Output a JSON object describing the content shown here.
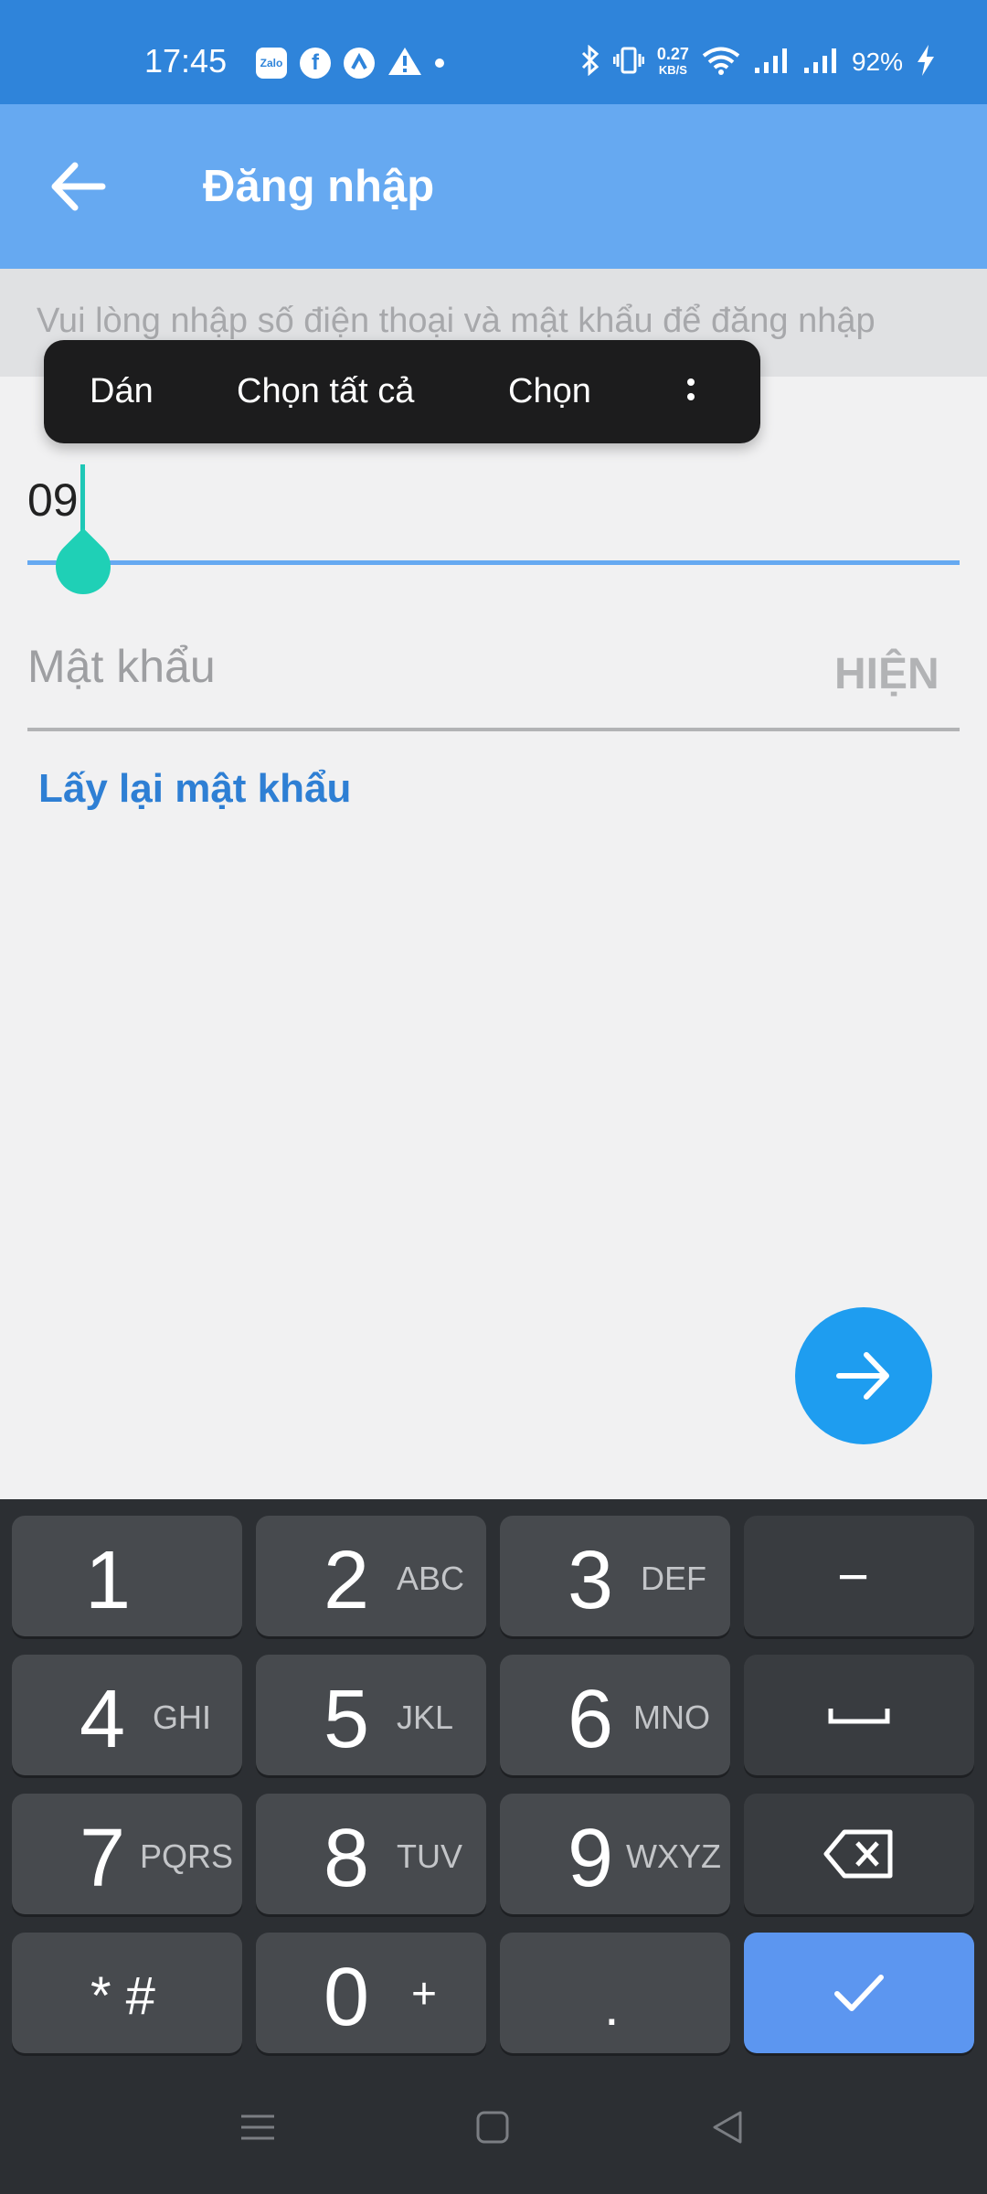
{
  "status_bar": {
    "time": "17:45",
    "notification_icons": [
      "zalo-icon",
      "facebook-icon",
      "arrow-up-icon",
      "warning-icon",
      "dot-icon"
    ],
    "zalo_label": "Zalo",
    "network_speed_value": "0.27",
    "network_speed_unit": "KB/S",
    "battery": "92%",
    "system_icons": [
      "bluetooth-icon",
      "vibrate-icon",
      "wifi-icon",
      "signal-icon",
      "signal-icon",
      "charging-icon"
    ]
  },
  "app_bar": {
    "title": "Đăng nhập",
    "back_icon": "arrow-left-icon"
  },
  "instruction": "Vui lòng nhập số điện thoại và mật khẩu để đăng nhập",
  "context_menu": {
    "items": [
      "Dán",
      "Chọn tất cả",
      "Chọn"
    ],
    "more_icon": "more-vertical-icon"
  },
  "phone_field": {
    "value": "09"
  },
  "password_field": {
    "placeholder": "Mật khẩu",
    "show_label": "HIỆN"
  },
  "forgot_password": "Lấy lại mật khẩu",
  "next_button_icon": "arrow-right-icon",
  "keyboard": {
    "rows": [
      [
        {
          "main": "1",
          "sub": ""
        },
        {
          "main": "2",
          "sub": "ABC"
        },
        {
          "main": "3",
          "sub": "DEF"
        },
        {
          "main": "−",
          "sub": ""
        }
      ],
      [
        {
          "main": "4",
          "sub": "GHI"
        },
        {
          "main": "5",
          "sub": "JKL"
        },
        {
          "main": "6",
          "sub": "MNO"
        },
        {
          "main": "",
          "sub": "",
          "icon": "space-icon"
        }
      ],
      [
        {
          "main": "7",
          "sub": "PQRS"
        },
        {
          "main": "8",
          "sub": "TUV"
        },
        {
          "main": "9",
          "sub": "WXYZ"
        },
        {
          "main": "",
          "sub": "",
          "icon": "backspace-icon"
        }
      ],
      [
        {
          "main": "* #",
          "sub": ""
        },
        {
          "main": "0",
          "sub": "+"
        },
        {
          "main": ".",
          "sub": ""
        },
        {
          "main": "",
          "sub": "",
          "icon": "check-icon"
        }
      ]
    ]
  },
  "nav_bar": [
    "menu-icon",
    "home-icon",
    "back-icon"
  ],
  "colors": {
    "status_bar": "#2f84da",
    "app_bar": "#66a9f1",
    "accent": "#1e9df0",
    "link": "#2e7fd4",
    "cursor": "#1fd0b6",
    "keyboard_bg": "#2c2f33",
    "confirm_key": "#5c96f0"
  }
}
